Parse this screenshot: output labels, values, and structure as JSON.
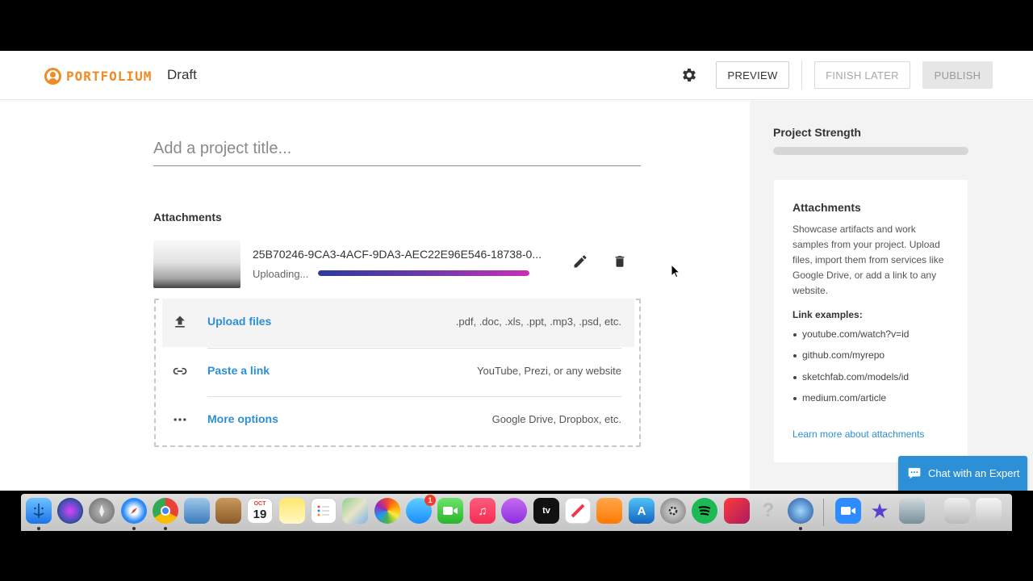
{
  "header": {
    "logo_text": "PORTFOLIUM",
    "status": "Draft",
    "preview_label": "PREVIEW",
    "finish_later_label": "FINISH LATER",
    "publish_label": "PUBLISH"
  },
  "editor": {
    "title_placeholder": "Add a project title...",
    "attachments_heading": "Attachments",
    "file": {
      "name": "25B70246-9CA3-4ACF-9DA3-AEC22E96E546-18738-0...",
      "status": "Uploading...",
      "progress_percent": 100
    },
    "options": [
      {
        "label": "Upload files",
        "hint": ".pdf, .doc, .xls, .ppt, .mp3, .psd, etc.",
        "icon": "upload-icon"
      },
      {
        "label": "Paste a link",
        "hint": "YouTube, Prezi, or any website",
        "icon": "link-icon"
      },
      {
        "label": "More options",
        "hint": "Google Drive, Dropbox, etc.",
        "icon": "more-icon"
      }
    ]
  },
  "sidebar": {
    "strength_title": "Project Strength",
    "card_title": "Attachments",
    "description": "Showcase artifacts and work samples from your project. Upload files, import them from services like Google Drive, or add a link to any website.",
    "link_examples_label": "Link examples:",
    "link_examples": [
      "youtube.com/watch?v=id",
      "github.com/myrepo",
      "sketchfab.com/models/id",
      "medium.com/article"
    ],
    "learn_more": "Learn more about attachments"
  },
  "chat": {
    "label": "Chat with an Expert"
  },
  "dock": {
    "calendar_month": "OCT",
    "calendar_day": "19",
    "messages_badge": "1",
    "tv_label": "tv",
    "apps": [
      "finder",
      "siri",
      "launchpad",
      "safari",
      "chrome",
      "preview",
      "contacts",
      "calendar",
      "notes",
      "reminders",
      "maps",
      "photos",
      "messages",
      "facetime",
      "music",
      "podcasts",
      "tv",
      "news",
      "books",
      "app-store",
      "system-preferences",
      "spotify",
      "creative-cloud",
      "help",
      "quicktime",
      "zoom",
      "imovie",
      "preview-2",
      "downloads",
      "trash"
    ],
    "colors": {
      "accent": "#2d8fd5",
      "brand": "#f08a24"
    }
  }
}
